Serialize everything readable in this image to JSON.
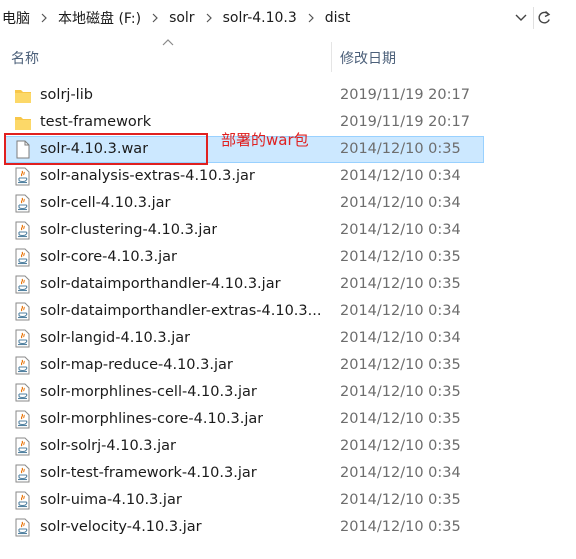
{
  "address_bar": {
    "crumbs": [
      "电脑",
      "本地磁盘 (F:)",
      "solr",
      "solr-4.10.3",
      "dist"
    ]
  },
  "columns": {
    "name": "名称",
    "date": "修改日期"
  },
  "files": [
    {
      "name": "solrj-lib",
      "date": "2019/11/19 20:17",
      "icon": "folder-icon",
      "selected": false
    },
    {
      "name": "test-framework",
      "date": "2019/11/19 20:17",
      "icon": "folder-icon",
      "selected": false
    },
    {
      "name": "solr-4.10.3.war",
      "date": "2014/12/10 0:35",
      "icon": "file-icon",
      "selected": true
    },
    {
      "name": "solr-analysis-extras-4.10.3.jar",
      "date": "2014/12/10 0:34",
      "icon": "java-jar-icon",
      "selected": false
    },
    {
      "name": "solr-cell-4.10.3.jar",
      "date": "2014/12/10 0:34",
      "icon": "java-jar-icon",
      "selected": false
    },
    {
      "name": "solr-clustering-4.10.3.jar",
      "date": "2014/12/10 0:34",
      "icon": "java-jar-icon",
      "selected": false
    },
    {
      "name": "solr-core-4.10.3.jar",
      "date": "2014/12/10 0:35",
      "icon": "java-jar-icon",
      "selected": false
    },
    {
      "name": "solr-dataimporthandler-4.10.3.jar",
      "date": "2014/12/10 0:35",
      "icon": "java-jar-icon",
      "selected": false
    },
    {
      "name": "solr-dataimporthandler-extras-4.10.3...",
      "date": "2014/12/10 0:34",
      "icon": "java-jar-icon",
      "selected": false
    },
    {
      "name": "solr-langid-4.10.3.jar",
      "date": "2014/12/10 0:34",
      "icon": "java-jar-icon",
      "selected": false
    },
    {
      "name": "solr-map-reduce-4.10.3.jar",
      "date": "2014/12/10 0:35",
      "icon": "java-jar-icon",
      "selected": false
    },
    {
      "name": "solr-morphlines-cell-4.10.3.jar",
      "date": "2014/12/10 0:35",
      "icon": "java-jar-icon",
      "selected": false
    },
    {
      "name": "solr-morphlines-core-4.10.3.jar",
      "date": "2014/12/10 0:35",
      "icon": "java-jar-icon",
      "selected": false
    },
    {
      "name": "solr-solrj-4.10.3.jar",
      "date": "2014/12/10 0:35",
      "icon": "java-jar-icon",
      "selected": false
    },
    {
      "name": "solr-test-framework-4.10.3.jar",
      "date": "2014/12/10 0:34",
      "icon": "java-jar-icon",
      "selected": false
    },
    {
      "name": "solr-uima-4.10.3.jar",
      "date": "2014/12/10 0:35",
      "icon": "java-jar-icon",
      "selected": false
    },
    {
      "name": "solr-velocity-4.10.3.jar",
      "date": "2014/12/10 0:35",
      "icon": "java-jar-icon",
      "selected": false
    }
  ],
  "annotation": {
    "text": "部署的war包",
    "color": "#e0201f"
  },
  "colors": {
    "selection_bg": "#cce8ff",
    "selection_border": "#99d1ff",
    "folder": "#f8c74a"
  }
}
